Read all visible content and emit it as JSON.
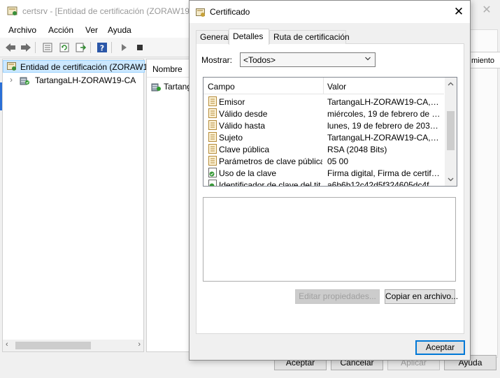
{
  "mmc": {
    "title": "certsrv - [Entidad de certificación (ZORAW19.",
    "menu": [
      "Archivo",
      "Acción",
      "Ver",
      "Ayuda"
    ],
    "tree": {
      "root_label": "Entidad de certificación (ZORAW1",
      "child_label": "TartangaLH-ZORAW19-CA"
    },
    "list": {
      "header": "Nombre",
      "item": "Tartang"
    }
  },
  "props_dialog": {
    "partial_column_text": "miento",
    "buttons": {
      "accept": "Aceptar",
      "cancel": "Cancelar",
      "apply": "Aplicar",
      "help": "Ayuda"
    }
  },
  "cert_dialog": {
    "title": "Certificado",
    "tabs": [
      "General",
      "Detalles",
      "Ruta de certificación"
    ],
    "active_tab": "Detalles",
    "show": {
      "label": "Mostrar:",
      "value": "<Todos>"
    },
    "fields": {
      "col_field": "Campo",
      "col_value": "Valor",
      "rows": [
        {
          "name": "Emisor",
          "value": "TartangaLH-ZORAW19-CA, Ta...",
          "icon": "certificate-field-icon"
        },
        {
          "name": "Válido desde",
          "value": "miércoles, 19 de febrero de 20...",
          "icon": "certificate-field-icon"
        },
        {
          "name": "Válido hasta",
          "value": "lunes, 19 de febrero de 2035 ...",
          "icon": "certificate-field-icon"
        },
        {
          "name": "Sujeto",
          "value": "TartangaLH-ZORAW19-CA, Ta...",
          "icon": "certificate-field-icon"
        },
        {
          "name": "Clave pública",
          "value": "RSA (2048 Bits)",
          "icon": "certificate-field-icon"
        },
        {
          "name": "Parámetros de clave pública",
          "value": "05 00",
          "icon": "certificate-field-icon"
        },
        {
          "name": "Uso de la clave",
          "value": "Firma digital, Firma de certifica...",
          "icon": "extension-field-icon"
        },
        {
          "name": "Identificador de clave del tit...",
          "value": "a6b6b12c42d5f324605dc4f2f...",
          "icon": "extension-field-icon"
        }
      ]
    },
    "buttons": {
      "edit_properties": "Editar propiedades...",
      "copy_to_file": "Copiar en archivo...",
      "accept": "Aceptar"
    }
  },
  "colors": {
    "selection": "#cce8ff",
    "accent": "#0078d7"
  }
}
